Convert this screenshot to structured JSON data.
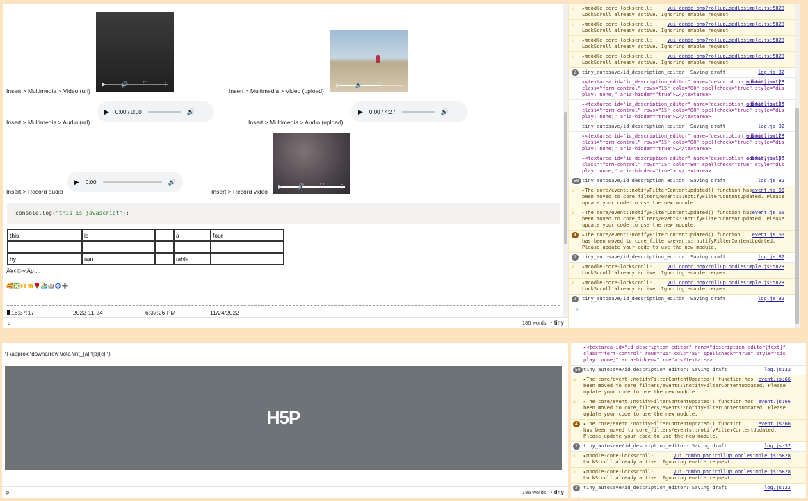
{
  "editor1": {
    "rows": [
      {
        "label": "Insert > Multimedia > Video (url)"
      },
      {
        "label": "Insert > Multimedia > Video (upload)"
      },
      {
        "label": "Insert > Multimedia > Audio (url)"
      },
      {
        "label": "Insert > Multimedia > Audio (upload)"
      },
      {
        "label": "Insert > Record audio"
      },
      {
        "label": "Insert > Record video"
      }
    ],
    "audio_url_time": "0:00 / 0:00",
    "audio_upload_time": "0:00 / 4:27",
    "record_audio_time": "0:00",
    "code": {
      "obj": "console",
      "fn": ".log(",
      "str": "\"this is javascript\"",
      "end": ");"
    },
    "table": [
      [
        "this",
        "is",
        "",
        "a",
        "four"
      ],
      [
        "",
        "",
        "",
        "",
        ""
      ],
      [
        "by",
        "two",
        "",
        "table",
        ""
      ]
    ],
    "mojibake": "Ã¥¢©‚∞Ãp ...",
    "emoji": "🥰❎🙌👏🌹🏄🏰🧿➕",
    "datetimes": [
      "18:37:17",
      "2022-11-24",
      "6:37:26 PM",
      "11/24/2022"
    ],
    "status_path": "p",
    "word_count": "186 words",
    "brand": "tiny"
  },
  "editor2": {
    "tex": "\\( \\approx \\downarrow \\iota \\int_{a}^{b}{c} \\)",
    "h5p_logo": "H5P",
    "status_path": "p",
    "word_count": "186 words",
    "brand": "tiny"
  },
  "console1": [
    {
      "type": "warn",
      "text": "▸moodle-core-lockscroll:\nLockScroll already active. Ignoring enable request",
      "src": "yui_combo.php?rollup…oodlesimple.js:5828"
    },
    {
      "type": "warn",
      "text": "▸moodle-core-lockscroll:\nLockScroll already active. Ignoring enable request",
      "src": "yui_combo.php?rollup…oodlesimple.js:5828"
    },
    {
      "type": "warn",
      "text": "▸moodle-core-lockscroll:\nLockScroll already active. Ignoring enable request",
      "src": "yui_combo.php?rollup…oodlesimple.js:5828"
    },
    {
      "type": "warn",
      "text": "▸moodle-core-lockscroll:\nLockScroll already active. Ignoring enable request",
      "src": "yui_combo.php?rollup…oodlesimple.js:5828"
    },
    {
      "type": "info",
      "count": "2",
      "text": "tiny_autosave/id_description_editor: Saving draft",
      "src": "log.js:32"
    },
    {
      "type": "el",
      "text": "▸<textarea id=\"id_description_editor\" name=\"description_editor[text]\"\nclass=\"form-control\" rows=\"15\" cols=\"80\" spellcheck=\"true\" style=\"dis\nplay: none;\" aria-hidden=\"true\">…</textarea>",
      "src": "submit.js:128"
    },
    {
      "type": "el",
      "text": "▸<textarea id=\"id_description_editor\" name=\"description_editor[text]\"\nclass=\"form-control\" rows=\"15\" cols=\"80\" spellcheck=\"true\" style=\"dis\nplay: none;\" aria-hidden=\"true\">…</textarea>",
      "src": "submit.js:135"
    },
    {
      "type": "info",
      "text": "tiny_autosave/id_description_editor: Saving draft",
      "src": "log.js:32"
    },
    {
      "type": "el",
      "text": "▸<textarea id=\"id_description_editor\" name=\"description_editor[text]\"\nclass=\"form-control\" rows=\"15\" cols=\"80\" spellcheck=\"true\" style=\"dis\nplay: none;\" aria-hidden=\"true\">…</textarea>",
      "src": "submit.js:128"
    },
    {
      "type": "el",
      "text": "▸<textarea id=\"id_description_editor\" name=\"description_editor[text]\"\nclass=\"form-control\" rows=\"15\" cols=\"80\" spellcheck=\"true\" style=\"dis\nplay: none;\" aria-hidden=\"true\">…</textarea>",
      "src": "submit.js:135"
    },
    {
      "type": "info",
      "count": "50",
      "text": "tiny_autosave/id_description_editor: Saving draft",
      "src": "log.js:32"
    },
    {
      "type": "warn",
      "text": "▸The core/event::notifyFilterContentUpdated() function has\nbeen moved to core_filters/events::notifyFilterContentUpdated. Please\nupdate your code to use the new module.",
      "src": "event.js:66"
    },
    {
      "type": "warn",
      "text": "▸The core/event::notifyFilterContentUpdated() function has\nbeen moved to core_filters/events::notifyFilterContentUpdated. Please\nupdate your code to use the new module.",
      "src": "event.js:66"
    },
    {
      "type": "warn",
      "count": "4",
      "text": "▸The core/event::notifyFilterContentUpdated() function\nhas been moved to core_filters/events::notifyFilterContentUpdated.\nPlease update your code to use the new module.",
      "src": "event.js:66"
    },
    {
      "type": "info",
      "count": "2",
      "text": "tiny_autosave/id_description_editor: Saving draft",
      "src": "log.js:32"
    },
    {
      "type": "warn",
      "text": "▸moodle-core-lockscroll:\nLockScroll already active. Ignoring enable request",
      "src": "yui_combo.php?rollup…oodlesimple.js:5828"
    },
    {
      "type": "warn",
      "text": "▸moodle-core-lockscroll:\nLockScroll already active. Ignoring enable request",
      "src": "yui_combo.php?rollup…oodlesimple.js:5828"
    },
    {
      "type": "info",
      "count": "2",
      "text": "tiny_autosave/id_description_editor: Saving draft",
      "src": "log.js:32"
    }
  ],
  "console2": [
    {
      "type": "el",
      "text": "▸<textarea id=\"id_description_editor\" name=\"description_editor[text]\"\nclass=\"form-control\" rows=\"15\" cols=\"80\" spellcheck=\"true\" style=\"dis\nplay: none;\" aria-hidden=\"true\">…</textarea>",
      "src": ""
    },
    {
      "type": "info",
      "count": "50",
      "text": "tiny_autosave/id_description_editor: Saving draft",
      "src": "log.js:32"
    },
    {
      "type": "warn",
      "text": "▸The core/event::notifyFilterContentUpdated() function has\nbeen moved to core_filters/events::notifyFilterContentUpdated. Please\nupdate your code to use the new module.",
      "src": "event.js:66"
    },
    {
      "type": "warn",
      "text": "▸The core/event::notifyFilterContentUpdated() function has\nbeen moved to core_filters/events::notifyFilterContentUpdated. Please\nupdate your code to use the new module.",
      "src": "event.js:66"
    },
    {
      "type": "warn",
      "count": "4",
      "text": "▸The core/event::notifyFilterContentUpdated() function\nhas been moved to core_filters/events::notifyFilterContentUpdated.\nPlease update your code to use the new module.",
      "src": "event.js:66"
    },
    {
      "type": "info",
      "count": "2",
      "text": "tiny_autosave/id_description_editor: Saving draft",
      "src": "log.js:32"
    },
    {
      "type": "warn",
      "text": "▸moodle-core-lockscroll:\nLockScroll already active. Ignoring enable request",
      "src": "yui_combo.php?rollup…oodlesimple.js:5828"
    },
    {
      "type": "warn",
      "text": "▸moodle-core-lockscroll:\nLockScroll already active. Ignoring enable request",
      "src": "yui_combo.php?rollup…oodlesimple.js:5828"
    },
    {
      "type": "info",
      "count": "2",
      "text": "tiny_autosave/id_description_editor: Saving draft",
      "src": "log.js:32"
    }
  ]
}
